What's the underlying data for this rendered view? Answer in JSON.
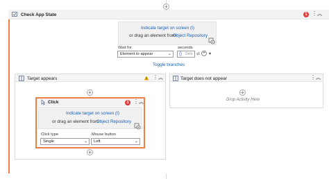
{
  "outer": {
    "title": "Check App State",
    "error_count": "1",
    "wait_for_label": "Wait for",
    "wait_for_value": "Element to appear",
    "seconds_label": "seconds",
    "seconds_placeholder": "Defa",
    "toggle_branches": "Toggle branches",
    "target": {
      "indicate_link": "Indicate target on screen (I)",
      "drag_text": "or drag an element from",
      "repository_link": "Object Repository"
    }
  },
  "branches": {
    "appears_title": "Target appears",
    "not_appear_title": "Target does not appear",
    "drop_activity": "Drop Activity Here"
  },
  "click": {
    "title": "Click",
    "error_count": "1",
    "target": {
      "indicate_link": "Indicate target on screen (I)",
      "drag_text": "or drag an element from",
      "repository_link": "Object Repository"
    },
    "click_type_label": "Click type",
    "click_type_value": "Single",
    "mouse_button_label": "Mouse button",
    "mouse_button_value": "Left"
  },
  "colors": {
    "accent_orange": "#f07f45",
    "link_blue": "#1a5fb4",
    "error_red": "#e03b3b",
    "warning_yellow": "#f2b600"
  }
}
